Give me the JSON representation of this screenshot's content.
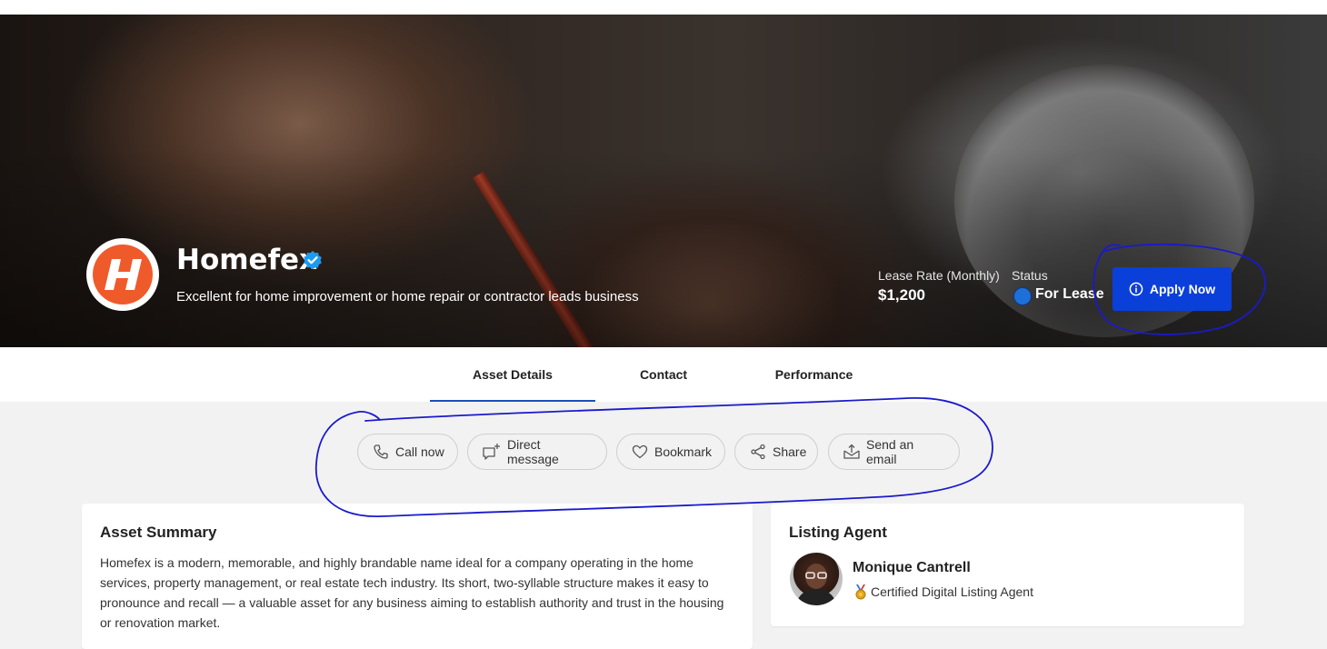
{
  "hero": {
    "brand_name": "Homefex",
    "tagline": "Excellent for home improvement or home repair or contractor leads business",
    "logo_letter": "H",
    "lease_rate_label": "Lease Rate (Monthly)",
    "lease_rate_value": "$1,200",
    "status_label": "Status",
    "status_value": "For Lease",
    "apply_label": "Apply Now"
  },
  "tabs": [
    {
      "label": "Asset Details",
      "active": true
    },
    {
      "label": "Contact",
      "active": false
    },
    {
      "label": "Performance",
      "active": false
    }
  ],
  "actions": [
    {
      "label": "Call now",
      "icon": "phone-icon"
    },
    {
      "label": "Direct message",
      "icon": "chat-plus-icon"
    },
    {
      "label": "Bookmark",
      "icon": "heart-icon"
    },
    {
      "label": "Share",
      "icon": "share-icon"
    },
    {
      "label": "Send an email",
      "icon": "mail-upload-icon"
    }
  ],
  "asset_summary": {
    "title": "Asset Summary",
    "lines": [
      "Homefex is a modern, memorable, and highly brandable name ideal for a company operating in the home",
      "services, property management, or real estate tech industry. Its short, two-syllable structure makes it easy to",
      "pronounce and recall — a valuable asset for any business aiming to establish authority and trust in the housing",
      "or renovation market."
    ]
  },
  "listing_agent": {
    "title": "Listing Agent",
    "name": "Monique Cantrell",
    "role": "Certified Digital Listing Agent"
  },
  "colors": {
    "accent": "#0b3fd9",
    "brand_orange": "#ef5a2a",
    "verified": "#1d9bf0",
    "annotation": "#1a1acc"
  }
}
